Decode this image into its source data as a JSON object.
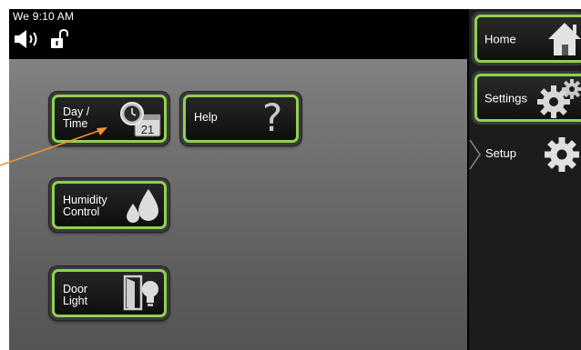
{
  "status": {
    "clock": "We 9:10 AM",
    "icons": [
      "speaker-icon",
      "unlocked-padlock-icon"
    ]
  },
  "tiles": [
    {
      "label": "Day /\nTime",
      "icon": "clock-calendar-icon",
      "calendar_day": "21"
    },
    {
      "label": "Help",
      "icon": "question-mark-icon",
      "icon_text": "?"
    },
    {
      "label": "Humidity\nControl",
      "icon": "water-drops-icon"
    },
    {
      "label": "Door\nLight",
      "icon": "door-lightbulb-icon"
    }
  ],
  "sidebar": {
    "items": [
      {
        "label": "Home",
        "icon": "house-icon"
      },
      {
        "label": "Settings",
        "icon": "gears-icon"
      },
      {
        "label": "Setup",
        "icon": "gear-icon"
      }
    ]
  },
  "colors": {
    "accent": "#8fd14f",
    "annotation_arrow": "#f0913a"
  }
}
